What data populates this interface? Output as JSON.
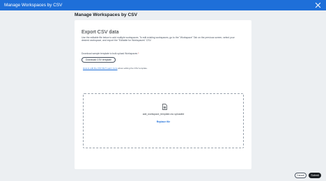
{
  "window": {
    "title": "Manage Workspaces by CSV",
    "close_icon": "close-icon"
  },
  "page": {
    "heading": "Manage Workspaces by CSV"
  },
  "export": {
    "title": "Export CSV data",
    "description": "Use the editable file below to add multiple workspaces. To edit existing workspaces, go to the \"Workspace\" Tab on the previous screen, select your desired workspace, and export the \"Editable for Workspaces\" CSV.",
    "download_label": "Download sample template to bulk upload Workspaces",
    "required_mark": "*",
    "download_button": "Download CSV template",
    "help_link": "How to edit the CSV file? Learn more",
    "help_rest": " about editing the CSV template."
  },
  "upload": {
    "file_icon": "file-icon",
    "file_name": "add_workspace_template.csv uploaded",
    "replace_label": "Replace file"
  },
  "footer": {
    "cancel_label": "Cancel",
    "submit_label": "Submit"
  },
  "colors": {
    "titlebar": "#1e6fd9",
    "link": "#1e6fd9",
    "submit_bg": "#1b1f23",
    "background": "#eceff2"
  }
}
